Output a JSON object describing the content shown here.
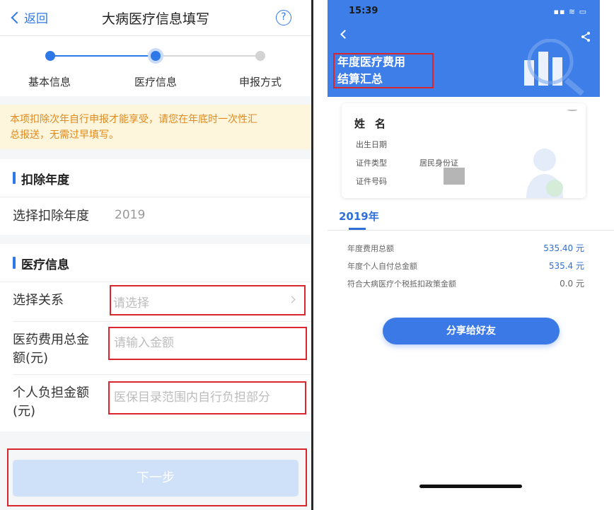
{
  "left": {
    "nav": {
      "back_label": "返回",
      "title": "大病医疗信息填写",
      "help_label": "?"
    },
    "steps": [
      "基本信息",
      "医疗信息",
      "申报方式"
    ],
    "notice": {
      "line1": "本项扣除次年自行申报才能享受，请您在年底时一次性汇",
      "line2": "总报送，无需过早填写。"
    },
    "deduction_section": {
      "title": "扣除年度",
      "row_label": "选择扣除年度",
      "row_value": "2019"
    },
    "medical_section": {
      "title": "医疗信息",
      "relation": {
        "label": "选择关系",
        "placeholder": "请选择"
      },
      "total": {
        "label_line1": "医药费用总金",
        "label_line2": "额(元)",
        "placeholder": "请输入金额"
      },
      "personal": {
        "label_line1": "个人负担金额",
        "label_line2": "(元)",
        "placeholder": "医保目录范围内自行负担部分"
      }
    },
    "next_button": "下一步"
  },
  "right": {
    "status": {
      "time": "15:39",
      "icons": "▪▪ ≋ ▭"
    },
    "title_line1": "年度医疗费用",
    "title_line2": "结算汇总",
    "card": {
      "name_label": "姓名",
      "birth_label": "出生日期",
      "id_type_label": "证件类型",
      "id_type_value": "居民身份证",
      "id_number_label": "证件号码"
    },
    "year": "2019年",
    "rows": [
      {
        "label": "年度费用总额",
        "value": "535.40 元"
      },
      {
        "label": "年度个人自付总金额",
        "value": "535.4 元"
      },
      {
        "label": "符合大病医疗个税抵扣政策金额",
        "value": "0.0 元"
      }
    ],
    "share_button": "分享给好友"
  }
}
